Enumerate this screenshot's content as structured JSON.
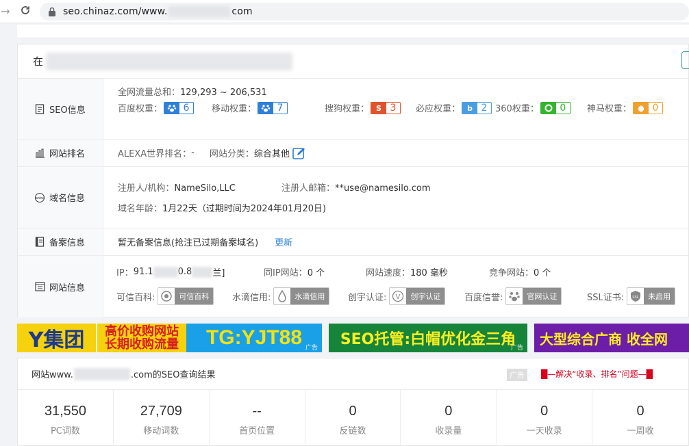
{
  "browser": {
    "url_prefix": "seo.chinaz.com/www.",
    "url_suffix": "com"
  },
  "panel": {
    "head_prefix": "在",
    "seo": {
      "label": "SEO信息",
      "traffic_label": "全网流量总和：",
      "traffic_value": "129,293 ~ 206,531",
      "weights": [
        {
          "label": "百度权重：",
          "value": "6",
          "icon": "baidu-paw-icon",
          "color": "#2f7fd8"
        },
        {
          "label": "移动权重：",
          "value": "7",
          "icon": "baidu-paw-icon",
          "color": "#2f7fd8"
        },
        {
          "label": "搜狗权重：",
          "value": "3",
          "icon": "sogou-icon",
          "color": "#e0532c"
        },
        {
          "label": "必应权重：",
          "value": "2",
          "icon": "bing-icon",
          "color": "#4a9de0"
        },
        {
          "label": "360权重：",
          "value": "0",
          "icon": "360-icon",
          "color": "#35b52e"
        },
        {
          "label": "神马权重：",
          "value": "0",
          "icon": "shenma-icon",
          "color": "#f0a030"
        }
      ]
    },
    "rank": {
      "label": "网站排名",
      "alexa_label": "ALEXA世界排名：",
      "alexa_value": "-",
      "category_label": "网站分类：",
      "category_value": "综合其他"
    },
    "domain": {
      "label": "域名信息",
      "registrant_label": "注册人/机构：",
      "registrant_value": "NameSilo,LLC",
      "email_label": "注册人邮箱：",
      "email_value": "**use@namesilo.com",
      "age_label": "域名年龄：",
      "age_value": "1月22天（过期时间为2024年01月20日)"
    },
    "icp": {
      "label": "备案信息",
      "text": "暂无备案信息(抢注已过期备案域名)",
      "update_link": "更新"
    },
    "site": {
      "label": "网站信息",
      "ip_label": "IP：",
      "ip_part1": "91.1",
      "ip_part2": "0.8",
      "ip_part3": "兰]",
      "same_ip_label": "同IP网站：",
      "same_ip_value": "0 个",
      "speed_label": "网站速度：",
      "speed_value": "180 毫秒",
      "compete_label": "竞争网站：",
      "compete_value": "0 个",
      "verifications": [
        {
          "label": "可信百科:",
          "badge": "可信百科"
        },
        {
          "label": "水滴信用:",
          "badge": "水滴信用"
        },
        {
          "label": "创宇认证:",
          "badge": "创宇认证"
        },
        {
          "label": "百度信誉:",
          "badge": "官网认证"
        },
        {
          "label": "SSL证书:",
          "badge": "未启用"
        }
      ]
    }
  },
  "ads": {
    "ad1_left": "Y集团",
    "ad1_mid_top": "高价收购网站",
    "ad1_mid_bottom": "长期收购流量",
    "ad1_right": "TG:YJT88",
    "ad2": "SEO托管:白帽优化金三角",
    "ad3": "大型综合广商 收全网",
    "ad_tag": "广告"
  },
  "result": {
    "title_prefix": "网站www.",
    "title_suffix": ".com的SEO查询结果",
    "ad_gray": "广告",
    "ad_red": "█—解决“收录、排名”问题—█",
    "stats": [
      {
        "value": "31,550",
        "label": "PC词数"
      },
      {
        "value": "27,709",
        "label": "移动词数"
      },
      {
        "value": "--",
        "label": "首页位置"
      },
      {
        "value": "0",
        "label": "反链数"
      },
      {
        "value": "0",
        "label": "收录量"
      },
      {
        "value": "0",
        "label": "一天收录"
      },
      {
        "value": "0",
        "label": "一周收"
      }
    ]
  }
}
